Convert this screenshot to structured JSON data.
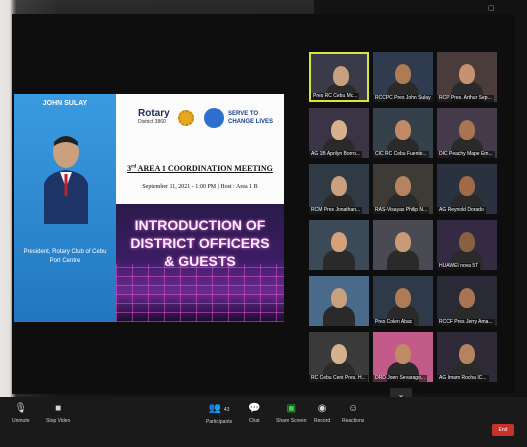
{
  "presenter": {
    "name": "JOHN SULAY",
    "title": "President, Rotary Club of Cebu Port Centre"
  },
  "slide": {
    "rotary": "Rotary",
    "district": "District 3860",
    "serve": "SERVE TO CHANGE LIVES",
    "meeting_prefix": "3",
    "meeting_sup": "rd",
    "meeting_title": "AREA 1 COORDINATION MEETING",
    "meeting_date": "September 11, 2021 - 1:00 PM | Host : Area 1 B",
    "intro_line1": "INTRODUCTION OF",
    "intro_line2": "DISTRICT OFFICERS",
    "intro_line3": "& GUESTS"
  },
  "gallery": {
    "tiles": [
      {
        "name": "Pres RC Cebu Mc..."
      },
      {
        "name": "RCCPC Pres John Sulay"
      },
      {
        "name": "RCP Pres. Arthur Sep..."
      },
      {
        "name": "AG 1B Aprilyn Borro..."
      },
      {
        "name": "CIC RC Cebu Fuente..."
      },
      {
        "name": "DIC Peachy Mape Em..."
      },
      {
        "name": "RCM Pres Jonathan..."
      },
      {
        "name": "RAS-Visayas Philip N..."
      },
      {
        "name": "AG Reynold Dorado"
      },
      {
        "name": ""
      },
      {
        "name": ""
      },
      {
        "name": "HUAWEI nova 5T"
      },
      {
        "name": ""
      },
      {
        "name": "Pres Colen Abac"
      },
      {
        "name": "RCCF Pres Jerry Ama..."
      },
      {
        "name": "RC Cebu Cent Pres. H..."
      },
      {
        "name": "DRD Joen Sevarago..."
      },
      {
        "name": "AG Imam Rocha IC..."
      }
    ]
  },
  "toolbar": {
    "unmute": "Unmute",
    "stop_video": "Stop Video",
    "participants_count": "43",
    "participants": "Participants",
    "chat": "Chat",
    "share_screen": "Share Screen",
    "record": "Record",
    "reactions": "Reactions"
  },
  "colors": {
    "accent_active": "#d6e63a",
    "share_green": "#3fcf4a",
    "end_red": "#c8322c"
  }
}
